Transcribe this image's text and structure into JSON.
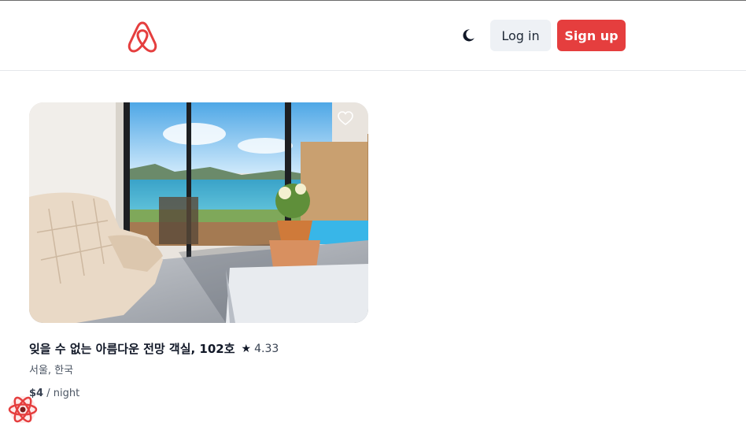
{
  "header": {
    "logo_icon": "airbnb-logo-icon",
    "theme_icon": "moon-icon",
    "login_label": "Log in",
    "signup_label": "Sign up"
  },
  "listing": {
    "title": "잊을 수 없는 아름다운 전망 객실, 102호",
    "rating": "4.33",
    "location": "서울, 한국",
    "price": "$4",
    "price_unit": "/ night",
    "favorite_icon": "heart-icon",
    "star_icon": "star-icon"
  },
  "colors": {
    "brand": "#e53e3e",
    "login_bg": "#eef1f5",
    "text": "#111827"
  },
  "devtools_icon": "react-query-devtools-icon"
}
